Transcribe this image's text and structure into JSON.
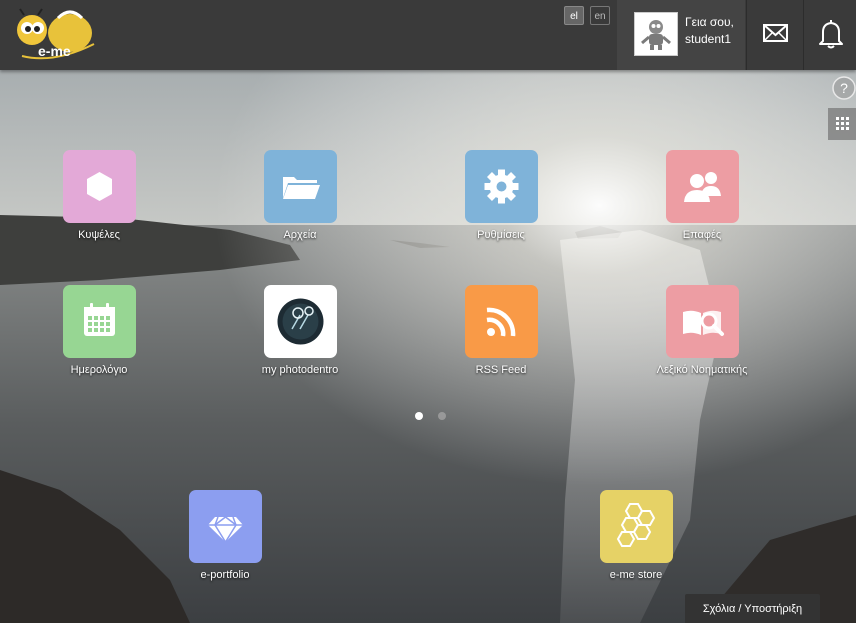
{
  "header": {
    "logo_text": "e-me",
    "languages": [
      {
        "code": "el",
        "active": true
      },
      {
        "code": "en",
        "active": false
      }
    ],
    "user": {
      "greeting": "Γεια σου,",
      "name": "student1"
    }
  },
  "apps_page1": [
    {
      "label": "Κυψέλες",
      "color": "#e3a9d7",
      "icon": "hexagon-icon"
    },
    {
      "label": "Αρχεία",
      "color": "#7fb3d9",
      "icon": "folder-icon"
    },
    {
      "label": "Ρυθμίσεις",
      "color": "#7fb3d9",
      "icon": "gear-icon"
    },
    {
      "label": "Επαφές",
      "color": "#ed9da3",
      "icon": "contacts-icon"
    },
    {
      "label": "Ημερολόγιο",
      "color": "#97d693",
      "icon": "calendar-icon"
    },
    {
      "label": "my photodentro",
      "color": "#ffffff",
      "icon": "photodentro-icon"
    },
    {
      "label": "RSS Feed",
      "color": "#f99a47",
      "icon": "rss-icon"
    },
    {
      "label": "Λεξικό Νοηματικής",
      "color": "#ed9da3",
      "icon": "dictionary-icon"
    }
  ],
  "pager": {
    "pages": 2,
    "current": 1
  },
  "dock": [
    {
      "label": "e-portfolio",
      "color": "#8c9ef0",
      "icon": "diamond-icon"
    },
    {
      "label": "e-me store",
      "color": "#e6d266",
      "icon": "honeycomb-icon"
    }
  ],
  "feedback_button": "Σχόλια / Υποστήριξη",
  "colors": {
    "topbar": "#3a3a3a",
    "user_block": "#444444"
  }
}
